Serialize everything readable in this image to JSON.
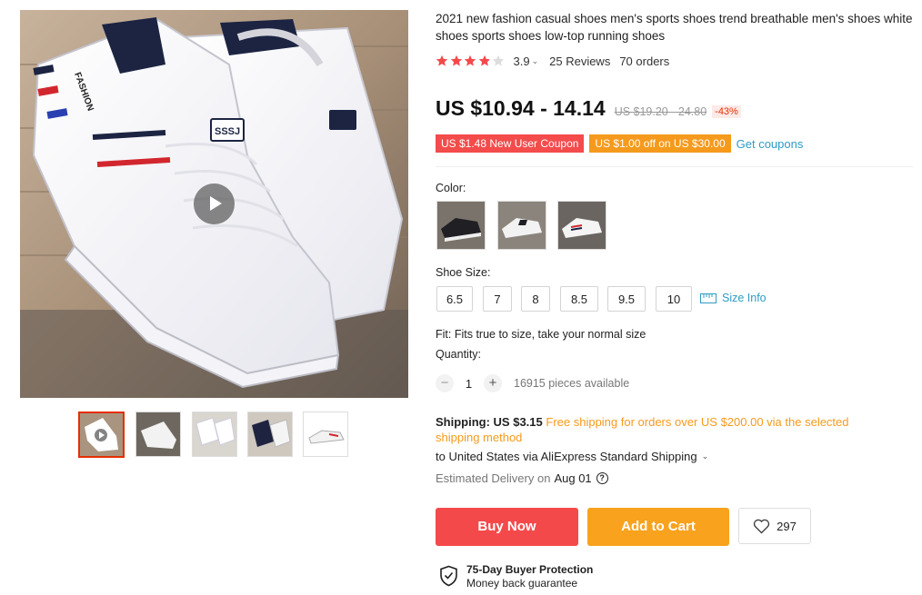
{
  "product": {
    "title": "2021 new fashion casual shoes men's sports shoes trend breathable men's shoes white shoes sports shoes low-top running shoes",
    "rating": "3.9",
    "rating_stars": 3.9,
    "reviews": "25 Reviews",
    "orders": "70 orders",
    "price": "US $10.94 - 14.14",
    "old_price": "US $19.20 - 24.80",
    "discount": "-43%",
    "shoe_logo_text": "SSSJ",
    "shoe_side_text": "FASHION"
  },
  "coupons": {
    "new_user": "US $1.48 New User Coupon",
    "off": "US $1.00 off on US $30.00",
    "get": "Get coupons"
  },
  "color": {
    "label": "Color:",
    "swatches": [
      "black-white",
      "white-black",
      "white-stripe"
    ]
  },
  "size": {
    "label": "Shoe Size:",
    "options": [
      "6.5",
      "7",
      "8",
      "8.5",
      "9.5",
      "10"
    ],
    "info": "Size Info"
  },
  "fit": "Fit: Fits true to size, take your normal size",
  "quantity": {
    "label": "Quantity:",
    "minus": "−",
    "value": "1",
    "plus": "+",
    "available": "16915 pieces available"
  },
  "shipping": {
    "label": "Shipping: US $3.15",
    "free": "Free shipping for orders over US $200.00 via the selected shipping method",
    "via": "to United States via AliExpress Standard Shipping",
    "estimated": "Estimated Delivery on",
    "date": "Aug 01"
  },
  "actions": {
    "buy": "Buy Now",
    "cart": "Add to Cart",
    "wishlist_count": "297"
  },
  "protection": {
    "title": "75-Day Buyer Protection",
    "subtitle": "Money back guarantee"
  },
  "icons": {
    "play": "play-icon",
    "star": "star-icon",
    "chevron": "chevron-down-icon",
    "ruler": "ruler-icon",
    "help": "help-icon",
    "heart": "heart-icon",
    "shield": "shield-check-icon"
  },
  "colors": {
    "accent_red": "#f4494b",
    "accent_orange": "#f8a21d",
    "link_blue": "#2e9cc3",
    "star": "#f4494b"
  }
}
